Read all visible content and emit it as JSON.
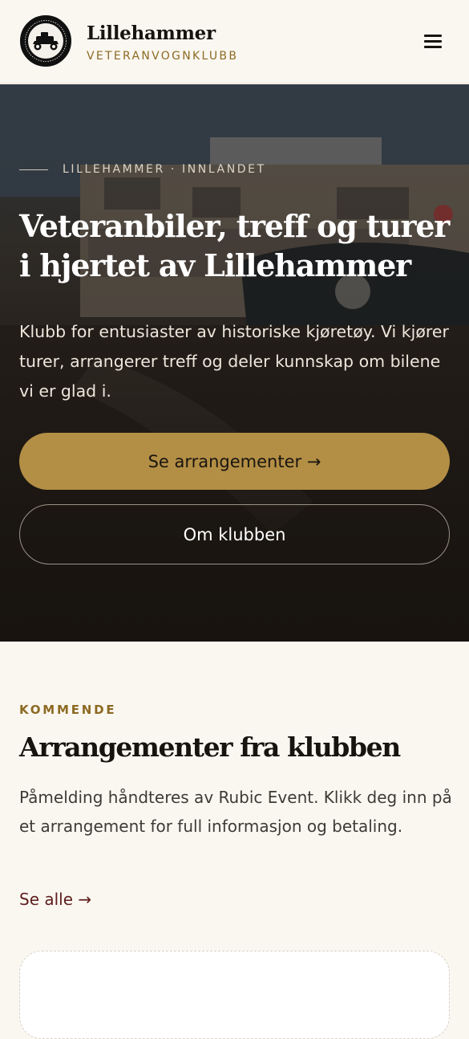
{
  "header": {
    "brand_name": "Lillehammer",
    "brand_sub": "VETERANVOGNKLUBB",
    "logo_text": "Lillehammer Veteranvognklubb 1975",
    "menu_icon": "hamburger-icon"
  },
  "hero": {
    "eyebrow": "LILLEHAMMER · INNLANDET",
    "title": "Veteranbiler, treff og turer i hjertet av Lillehammer",
    "text": "Klubb for entusiaster av historiske kjøretøy. Vi kjører turer, arrangerer treff og deler kunnskap om bilene vi er glad i.",
    "primary_button": "Se arrangementer →",
    "secondary_button": "Om klubben"
  },
  "events": {
    "kicker": "KOMMENDE",
    "title": "Arrangementer fra klubben",
    "text": "Påmelding håndteres av Rubic Event. Klikk deg inn på et arrangement for full informasjon og betaling.",
    "see_all": "Se alle →"
  },
  "colors": {
    "accent_gold": "#b38e45",
    "kicker_gold": "#8c6a22",
    "link_maroon": "#5e1d1d",
    "page_bg": "#faf7f1"
  }
}
